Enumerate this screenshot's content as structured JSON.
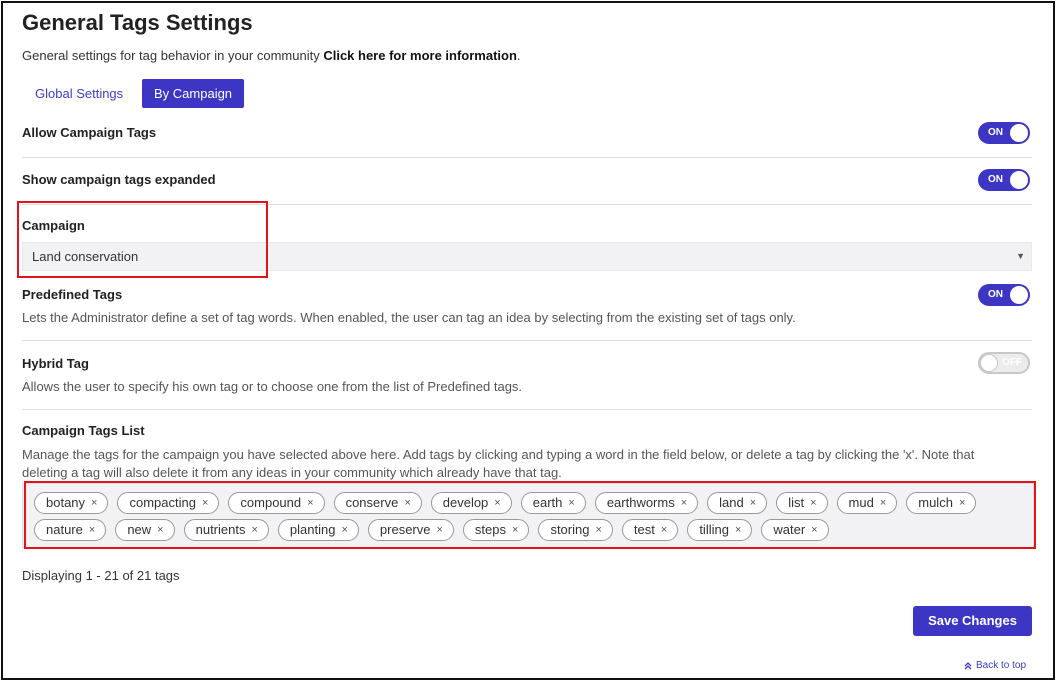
{
  "header": {
    "title": "General Tags Settings",
    "subtitle": "General settings for tag behavior in your community",
    "info_link": "Click here for more information",
    "info_suffix": "."
  },
  "tabs": [
    {
      "label": "Global Settings",
      "active": false
    },
    {
      "label": "By Campaign",
      "active": true
    }
  ],
  "settings": {
    "allow_campaign_tags": {
      "label": "Allow Campaign Tags",
      "state": "ON"
    },
    "show_expanded": {
      "label": "Show campaign tags expanded",
      "state": "ON"
    },
    "campaign": {
      "label": "Campaign",
      "selected": "Land conservation"
    },
    "predefined_tags": {
      "label": "Predefined Tags",
      "state": "ON",
      "description": "Lets the Administrator define a set of tag words. When enabled, the user can tag an idea by selecting from the existing set of tags only."
    },
    "hybrid_tag": {
      "label": "Hybrid Tag",
      "state": "OFF",
      "description": "Allows the user to specify his own tag or to choose one from the list of Predefined tags."
    }
  },
  "tags_list": {
    "label": "Campaign Tags List",
    "description_1": "Manage the tags for the campaign you have selected above here. Add tags by clicking and typing a word in the field below, or delete a tag by clicking the 'x'. Note that",
    "description_2": "deleting a tag will also delete it from any ideas in your community which already have that tag.",
    "tags": [
      "botany",
      "compacting",
      "compound",
      "conserve",
      "develop",
      "earth",
      "earthworms",
      "land",
      "list",
      "mud",
      "mulch",
      "nature",
      "new",
      "nutrients",
      "planting",
      "preserve",
      "steps",
      "storing",
      "test",
      "tilling",
      "water"
    ],
    "remove_glyph": "×",
    "count_text": "Displaying 1 - 21 of 21 tags"
  },
  "actions": {
    "save_label": "Save Changes",
    "back_to_top": "Back to top"
  },
  "colors": {
    "accent": "#3d35c4",
    "highlight_box": "#e3121b"
  }
}
